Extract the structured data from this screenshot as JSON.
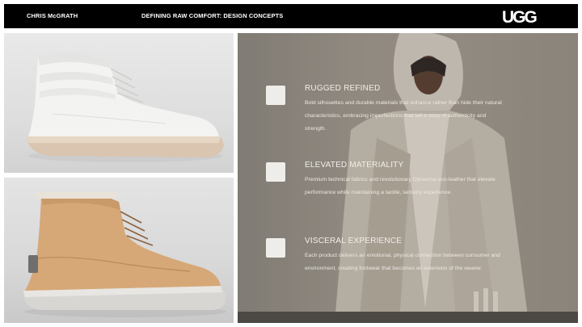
{
  "header": {
    "author": "CHRIS McGRATH",
    "deck_title": "DEFINING RAW COMFORT: DESIGN CONCEPTS",
    "logo_text": "UGG"
  },
  "images": {
    "top_left": "white-leather-high-top-sneaker-boot",
    "bottom_left": "tan-leather-high-top-boot",
    "right": "model-in-hooded-layered-outfit"
  },
  "features": [
    {
      "title": "RUGGED REFINED",
      "body": "Bold silhouettes and durable materials that enhance rather than hide their natural characteristics, embracing imperfections that tell a story of authenticity and strength."
    },
    {
      "title": "ELEVATED MATERIALITY",
      "body": "Premium technical fabrics and revolutionary Dyneema eco-leather that elevate performance while maintaining a tactile, sensory experience."
    },
    {
      "title": "VISCERAL EXPERIENCE",
      "body": "Each product delivers an emotional, physical connection between consumer and environment, creating footwear that becomes an extension of the wearer."
    }
  ],
  "colors": {
    "header_bg": "#000000",
    "accent_box": "#efedea",
    "boot_tan": "#d6a877",
    "boot_white": "#f2f2f0"
  }
}
